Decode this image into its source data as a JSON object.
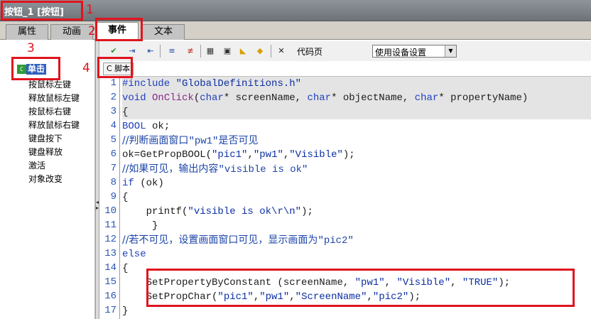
{
  "window": {
    "title": "按钮_1 [按钮]"
  },
  "tabs": [
    {
      "label": "属性",
      "active": false
    },
    {
      "label": "动画",
      "active": false
    },
    {
      "label": "事件",
      "active": true
    },
    {
      "label": "文本",
      "active": false
    }
  ],
  "tree": {
    "root_icon_text": "C",
    "root_label": "单击",
    "events": [
      "按鼠标左键",
      "释放鼠标左键",
      "按鼠标右键",
      "释放鼠标右键",
      "键盘按下",
      "键盘释放",
      "激活",
      "对象改变"
    ]
  },
  "toolbar": {
    "icons": [
      "check-compile-icon",
      "indent-icon",
      "outdent-icon",
      "comment-icon",
      "uncomment-icon",
      "tag-select-icon",
      "picture-select-icon",
      "function-icon",
      "object-icon",
      "close-icon"
    ],
    "codepage_label": "代码页",
    "device_select_value": "使用设备设置"
  },
  "script_tab": {
    "label": "C 脚本"
  },
  "code": {
    "line_numbers": [
      "1",
      "2",
      "3",
      "4",
      "5",
      "6",
      "7",
      "8",
      "9",
      "10",
      "11",
      "12",
      "13",
      "14",
      "15",
      "16",
      "17"
    ],
    "lines": {
      "l1": {
        "kw": "#include ",
        "str": "\"GlobalDefinitions.h\""
      },
      "l2": {
        "kw": "void ",
        "fn": "OnClick",
        "a": "(",
        "t1": "char",
        "b": "* screenName, ",
        "t2": "char",
        "c": "* objectName, ",
        "t3": "char",
        "d": "* propertyName)"
      },
      "l3": "{",
      "l4": {
        "kw": "BOOL",
        "rest": " ok;"
      },
      "l5": {
        "a": "//判断画面窗口",
        "b": "\"pw1\"",
        "c": "是否可见"
      },
      "l6": {
        "a": "ok=GetPropBOOL(",
        "s1": "\"pic1\"",
        "b": ",",
        "s2": "\"pw1\"",
        "c": ",",
        "s3": "\"Visible\"",
        "d": ");"
      },
      "l7": {
        "a": "//如果可见，输出内容",
        "b": "\"visible is ok\""
      },
      "l8": {
        "kw": "if",
        "rest": " (ok)"
      },
      "l9": "{",
      "l10": {
        "a": "    printf(",
        "s": "\"visible is ok\\r\\n\"",
        "b": ");"
      },
      "l11": "     }",
      "l12": {
        "a": "//若不可见，设置画面窗口可见，显示画面为",
        "b": "\"pic2\""
      },
      "l13": "else",
      "l14": "{",
      "l15": {
        "a": "    SetPropertyByConstant (screenName, ",
        "s1": "\"pw1\"",
        "b": ", ",
        "s2": "\"Visible\"",
        "c": ", ",
        "s3": "\"TRUE\"",
        "d": ");"
      },
      "l16": {
        "a": "    SetPropChar(",
        "s1": "\"pic1\"",
        "b": ",",
        "s2": "\"pw1\"",
        "c": ",",
        "s3": "\"ScreenName\"",
        "d": ",",
        "s4": "\"pic2\"",
        "e": ");"
      },
      "l17": "}"
    }
  },
  "annotations": [
    "1",
    "2",
    "3",
    "4"
  ],
  "colors": {
    "annotation_red": "#e0141e",
    "selection_blue": "#2e5fbd",
    "keyword_blue": "#1e3fbf"
  }
}
